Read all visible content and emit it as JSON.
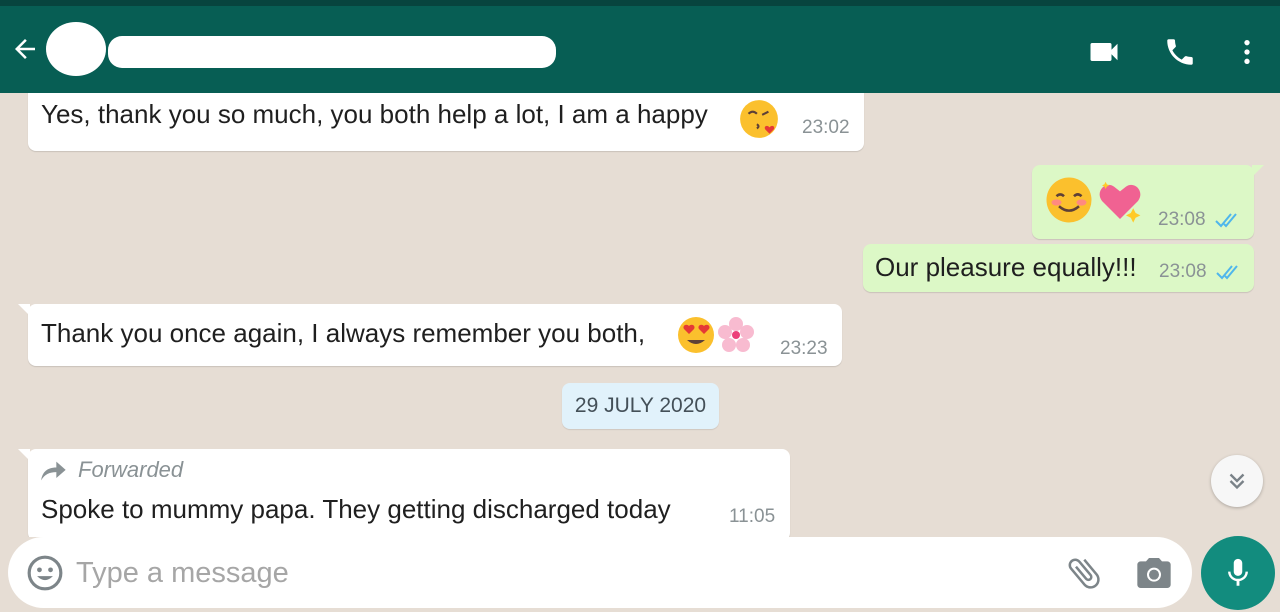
{
  "header": {
    "contact_name": "",
    "icons": [
      "back-arrow-icon",
      "video-call-icon",
      "voice-call-icon",
      "more-vert-icon"
    ]
  },
  "messages": [
    {
      "direction": "incoming",
      "text": "Yes, thank you so much, you both help a lot, I am a happy",
      "emoji": [
        "kissing-heart-emoji"
      ],
      "time": "23:02"
    },
    {
      "direction": "outgoing",
      "text": "",
      "emoji": [
        "smiling-blush-emoji",
        "sparkling-heart-emoji"
      ],
      "time": "23:08",
      "status": "read"
    },
    {
      "direction": "outgoing",
      "text": "Our pleasure equally!!!",
      "emoji": [],
      "time": "23:08",
      "status": "read"
    },
    {
      "direction": "incoming",
      "text": "Thank you once again, I always remember you both,",
      "emoji": [
        "heart-eyes-emoji",
        "cherry-blossom-emoji"
      ],
      "time": "23:23"
    }
  ],
  "date_separator": "29 JULY 2020",
  "forwarded_message": {
    "label": "Forwarded",
    "text": "Spoke to mummy papa. They getting discharged today",
    "time": "11:05"
  },
  "composer": {
    "placeholder": "Type a message",
    "value": ""
  },
  "colors": {
    "header": "#075e54",
    "chat_background": "#e6ddd4",
    "incoming_bubble": "#ffffff",
    "outgoing_bubble": "#dcf8c6",
    "read_ticks": "#4fb6ec",
    "fab": "#128c7e"
  }
}
